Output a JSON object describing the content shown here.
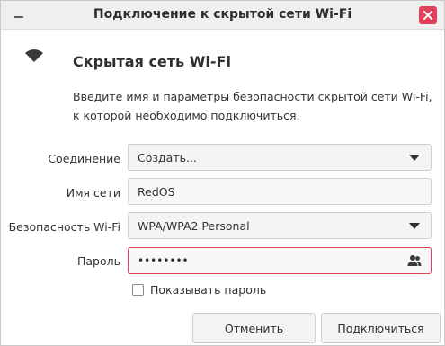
{
  "window": {
    "title": "Подключение к скрытой сети Wi-Fi"
  },
  "header": {
    "heading": "Скрытая сеть Wi-Fi",
    "description": "Введите имя и параметры безопасности скрытой сети Wi-Fi, к которой необходимо подключиться."
  },
  "form": {
    "connection": {
      "label": "Соединение",
      "value": "Создать..."
    },
    "network_name": {
      "label": "Имя сети",
      "value": "RedOS"
    },
    "security": {
      "label": "Безопасность Wi-Fi",
      "value": "WPA/WPA2 Personal"
    },
    "password": {
      "label": "Пароль",
      "value": "••••••••"
    },
    "show_password": {
      "label": "Показывать пароль",
      "checked": false
    }
  },
  "buttons": {
    "cancel": "Отменить",
    "connect": "Подключиться"
  },
  "colors": {
    "close_button": "#e0415a",
    "error_border": "#e0415a"
  },
  "icons": {
    "minimize": "minimize-icon",
    "close": "close-icon",
    "wifi": "wifi-icon",
    "combo_arrow": "chevron-down-icon",
    "password_visibility": "people-icon"
  }
}
